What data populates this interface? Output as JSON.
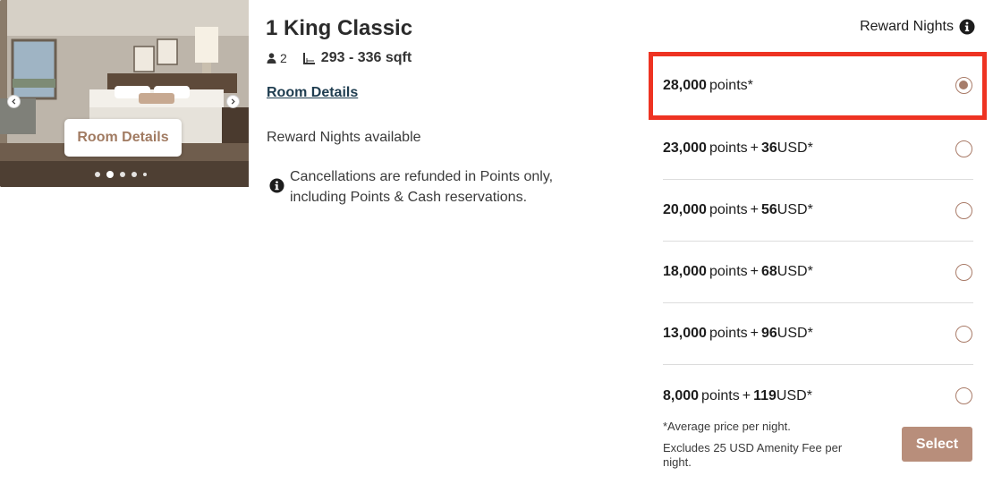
{
  "photo": {
    "overlay_label": "Room Details",
    "slides_count": 5,
    "active_slide": 2
  },
  "room": {
    "title": "1 King Classic",
    "occupancy": "2",
    "size": "293 - 336 sqft",
    "details_link": "Room Details",
    "availability": "Reward Nights available",
    "cancellation_note": "Cancellations are refunded in Points only, including Points & Cash reservations."
  },
  "rates": {
    "header": "Reward Nights",
    "points_word": "points",
    "plus_sign": "+",
    "currency_suffix": "USD*",
    "options": [
      {
        "points": "28,000",
        "suffix": "points*",
        "cash": "",
        "selected": true
      },
      {
        "points": "23,000",
        "suffix": "points",
        "cash": "36",
        "selected": false
      },
      {
        "points": "20,000",
        "suffix": "points",
        "cash": "56",
        "selected": false
      },
      {
        "points": "18,000",
        "suffix": "points",
        "cash": "68",
        "selected": false
      },
      {
        "points": "13,000",
        "suffix": "points",
        "cash": "96",
        "selected": false
      },
      {
        "points": "8,000",
        "suffix": "points",
        "cash": "119",
        "selected": false
      }
    ],
    "footnote": "*Average price per night.",
    "amenity_note": "Excludes 25 USD Amenity Fee per night.",
    "select_label": "Select"
  },
  "colors": {
    "accent": "#b88e7b",
    "highlight": "#ee3322",
    "link": "#1f3d50"
  }
}
